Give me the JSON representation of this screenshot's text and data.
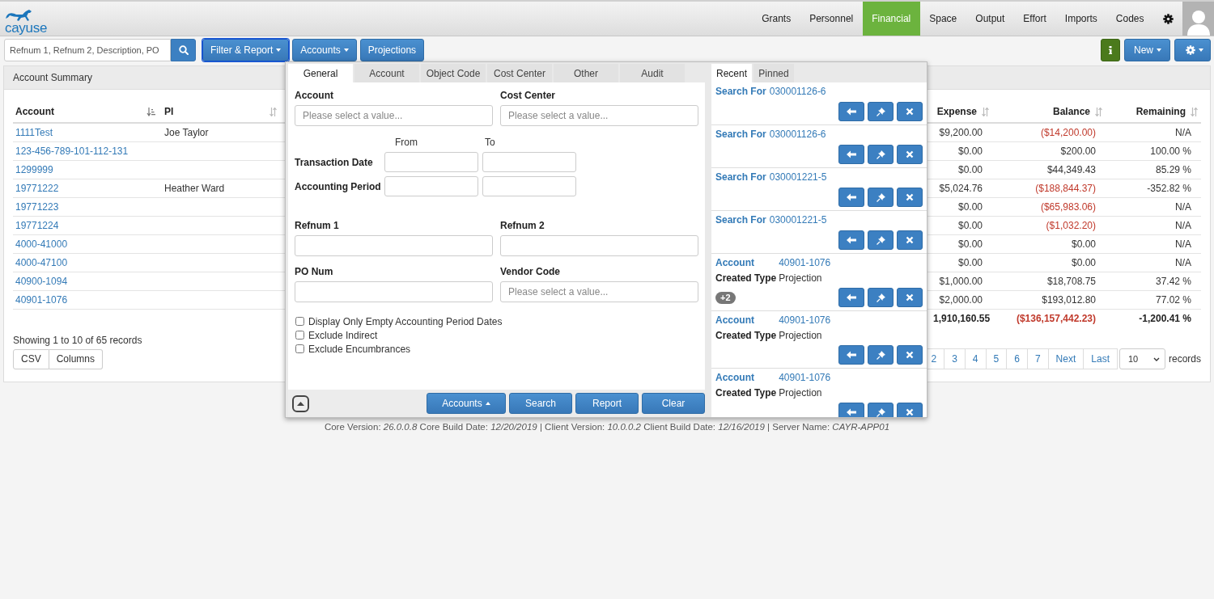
{
  "header": {
    "logo": "cayuse",
    "nav": [
      {
        "label": "Grants",
        "selected": false
      },
      {
        "label": "Personnel",
        "selected": false
      },
      {
        "label": "Financial",
        "selected": true
      },
      {
        "label": "Space",
        "selected": false
      },
      {
        "label": "Output",
        "selected": false
      },
      {
        "label": "Effort",
        "selected": false
      },
      {
        "label": "Imports",
        "selected": false
      },
      {
        "label": "Codes",
        "selected": false
      }
    ]
  },
  "toolbar": {
    "search": {
      "placeholder": "Refnum 1, Refnum 2, Description, PO"
    },
    "buttons": [
      {
        "label": "Filter & Report",
        "kind": "dropdown",
        "focused": true
      },
      {
        "label": "Accounts",
        "kind": "dropdown",
        "focused": false
      },
      {
        "label": "Projections",
        "kind": "plain",
        "focused": false
      }
    ],
    "right_buttons": [
      {
        "kind": "info"
      },
      {
        "kind": "dropdown",
        "label": "New"
      },
      {
        "kind": "settings"
      }
    ]
  },
  "account_summary": {
    "title": "Account Summary",
    "columns": [
      {
        "label": "Account",
        "kind": "text",
        "sorted": true
      },
      {
        "label": "PI",
        "kind": "text",
        "sorted": false
      },
      {
        "label": "Expense",
        "kind": "number",
        "sorted": false
      },
      {
        "label": "Balance",
        "kind": "number",
        "sorted": false
      },
      {
        "label": "Remaining",
        "kind": "number",
        "sorted": false
      }
    ],
    "rows": [
      {
        "kind": "data",
        "account": "1111Test",
        "pi": "Joe Taylor",
        "expense": "$9,200.00",
        "balance": "($14,200.00)",
        "negative": true,
        "remaining": "N/A"
      },
      {
        "kind": "data",
        "account": "123-456-789-101-112-131",
        "expense": "$0.00",
        "balance": "$200.00",
        "negative": false,
        "remaining": "100.00 %"
      },
      {
        "kind": "data",
        "account": "1299999",
        "expense": "$0.00",
        "balance": "$44,349.43",
        "negative": false,
        "remaining": "85.29 %"
      },
      {
        "kind": "data",
        "account": "19771222",
        "pi": "Heather Ward",
        "expense": "$5,024.76",
        "balance": "($188,844.37)",
        "negative": true,
        "remaining": "-352.82 %"
      },
      {
        "kind": "data",
        "account": "19771223",
        "expense": "$0.00",
        "balance": "($65,983.06)",
        "negative": true,
        "remaining": "N/A"
      },
      {
        "kind": "data",
        "account": "19771224",
        "expense": "$0.00",
        "balance": "($1,032.20)",
        "negative": true,
        "remaining": "N/A"
      },
      {
        "kind": "data",
        "account": "4000-41000",
        "expense": "$0.00",
        "balance": "$0.00",
        "negative": false,
        "remaining": "N/A"
      },
      {
        "kind": "data",
        "account": "4000-47100",
        "expense": "$0.00",
        "balance": "$0.00",
        "negative": false,
        "remaining": "N/A"
      },
      {
        "kind": "data",
        "account": "40900-1094",
        "expense": "$1,000.00",
        "balance": "$18,708.75",
        "negative": false,
        "remaining": "37.42 %"
      },
      {
        "kind": "data",
        "account": "40901-1076",
        "expense": "$2,000.00",
        "balance": "$193,012.80",
        "negative": false,
        "remaining": "77.02 %"
      },
      {
        "kind": "total",
        "expense": "1,910,160.55",
        "balance": "($136,157,442.23)",
        "negative": true,
        "remaining": "-1,200.41 %"
      }
    ],
    "record_info": "Showing 1 to 10 of 65 records",
    "export_buttons": [
      "CSV",
      "Columns"
    ],
    "pagination": {
      "pages": [
        {
          "label": "2",
          "selected": false
        },
        {
          "label": "3",
          "selected": false
        },
        {
          "label": "4",
          "selected": false
        },
        {
          "label": "5",
          "selected": false
        },
        {
          "label": "6",
          "selected": false
        },
        {
          "label": "7",
          "selected": false
        }
      ],
      "next": "Next",
      "last": "Last",
      "page_size": "10",
      "page_size_label": "records"
    }
  },
  "filter_popup": {
    "tabs": [
      {
        "label": "General",
        "selected": true
      },
      {
        "label": "Account",
        "selected": false
      },
      {
        "label": "Object Code",
        "selected": false
      },
      {
        "label": "Cost Center",
        "selected": false
      },
      {
        "label": "Other",
        "selected": false
      },
      {
        "label": "Audit",
        "selected": false
      }
    ],
    "select_fields": [
      {
        "label": "Account",
        "placeholder": "Please select a value..."
      },
      {
        "label": "Cost Center",
        "placeholder": "Please select a value..."
      }
    ],
    "date_ranges": {
      "from_label": "From",
      "to_label": "To",
      "rows": [
        {
          "label": "Transaction Date"
        },
        {
          "label": "Accounting Period"
        }
      ]
    },
    "text_fields": [
      {
        "label": "Refnum 1"
      },
      {
        "label": "Refnum 2"
      },
      {
        "label": "PO Num"
      },
      {
        "label": "Vendor Code",
        "placeholder": "Please select a value..."
      }
    ],
    "checkboxes": [
      {
        "label": "Display Only Empty Accounting Period Dates",
        "checked": false
      },
      {
        "label": "Exclude Indirect",
        "checked": false
      },
      {
        "label": "Exclude Encumbrances",
        "checked": false
      }
    ],
    "buttons": [
      {
        "label": "Accounts",
        "kind": "dropup"
      },
      {
        "label": "Search",
        "kind": "plain"
      },
      {
        "label": "Report",
        "kind": "plain"
      },
      {
        "label": "Clear",
        "kind": "plain"
      }
    ]
  },
  "recent_panel": {
    "tabs": [
      {
        "label": "Recent",
        "selected": true
      },
      {
        "label": "Pinned",
        "selected": false
      }
    ],
    "items": [
      {
        "kind": "search",
        "label": "Search For",
        "value": "030001126-6"
      },
      {
        "kind": "search",
        "label": "Search For",
        "value": "030001126-6"
      },
      {
        "kind": "search",
        "label": "Search For",
        "value": "030001221-5"
      },
      {
        "kind": "search",
        "label": "Search For",
        "value": "030001221-5"
      },
      {
        "kind": "account",
        "label": "Account",
        "value": "40901-1076",
        "type_label": "Created Type",
        "type_value": "Projection",
        "badge": "+2"
      },
      {
        "kind": "account",
        "label": "Account",
        "value": "40901-1076",
        "type_label": "Created Type",
        "type_value": "Projection"
      },
      {
        "kind": "account",
        "label": "Account",
        "value": "40901-1076",
        "type_label": "Created Type",
        "type_value": "Projection"
      }
    ]
  },
  "footer": "Core Version: *26.0.0.8* Core Build Date: *12/20/2019* | Client Version: *10.0.0.2* Client Build Date: *12/16/2019* | Server Name: *CAYR-APP01*"
}
